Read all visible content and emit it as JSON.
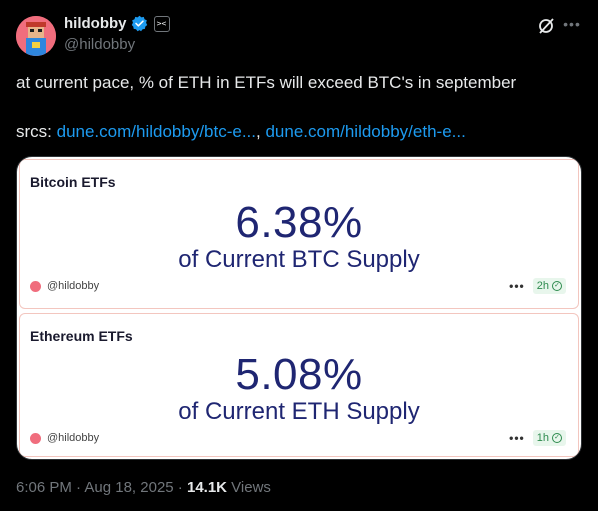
{
  "author": {
    "display_name": "hildobby",
    "handle": "@hildobby",
    "affiliation_badge": "pixel-mark"
  },
  "tweet": {
    "text": "at current pace, % of ETH in ETFs will exceed BTC's in september",
    "srcs_label": "srcs: ",
    "link1": "dune.com/hildobby/btc-e...",
    "separator": ", ",
    "link2": "dune.com/hildobby/eth-e..."
  },
  "cards": [
    {
      "title": "Bitcoin ETFs",
      "value": "6.38%",
      "subtitle": "of Current BTC Supply",
      "credit": "@hildobby",
      "dots": "•••",
      "age": "2h"
    },
    {
      "title": "Ethereum ETFs",
      "value": "5.08%",
      "subtitle": "of Current ETH Supply",
      "credit": "@hildobby",
      "dots": "•••",
      "age": "1h"
    }
  ],
  "footer": {
    "time": "6:06 PM",
    "sep1": " · ",
    "date": "Aug 18, 2025",
    "sep2": " · ",
    "views_count": "14.1K",
    "views_label": " Views"
  },
  "colors": {
    "background": "#000000",
    "link": "#1d9bf0",
    "muted": "#71767b",
    "text": "#e7e9ea",
    "card_number": "#1f2672",
    "verified": "#1d9bf0"
  }
}
